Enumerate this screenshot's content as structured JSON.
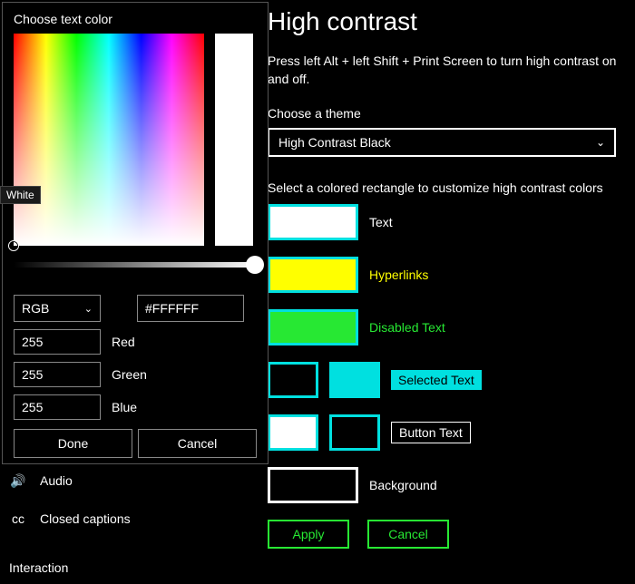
{
  "dialog": {
    "title": "Choose text color",
    "format_mode": "RGB",
    "hex": "#FFFFFF",
    "r": "255",
    "r_label": "Red",
    "g": "255",
    "g_label": "Green",
    "b": "255",
    "b_label": "Blue",
    "done": "Done",
    "cancel": "Cancel",
    "tooltip": "White"
  },
  "sidebar": {
    "audio": "Audio",
    "captions": "Closed captions",
    "interaction": "Interaction"
  },
  "page": {
    "title": "High contrast",
    "hint": "Press left Alt + left Shift + Print Screen to turn high contrast on and off.",
    "choose_theme": "Choose a theme",
    "theme": "High Contrast Black",
    "select_rect": "Select a colored rectangle to customize high contrast colors",
    "rows": {
      "text": "Text",
      "hyperlinks": "Hyperlinks",
      "disabled": "Disabled Text",
      "selected": "Selected Text",
      "button": "Button Text",
      "background": "Background"
    },
    "apply": "Apply",
    "cancel": "Cancel"
  },
  "colors": {
    "accent": "#00e0e0",
    "text_swatch": "#ffffff",
    "hyperlink_swatch": "#ffff00",
    "disabled_swatch": "#27e833",
    "selected_fg": "#000000",
    "selected_bg": "#00e0e0",
    "button_fg": "#ffffff",
    "button_bg": "#000000",
    "background_swatch": "#000000",
    "apply_border": "#27e833",
    "apply_text": "#27e833"
  }
}
